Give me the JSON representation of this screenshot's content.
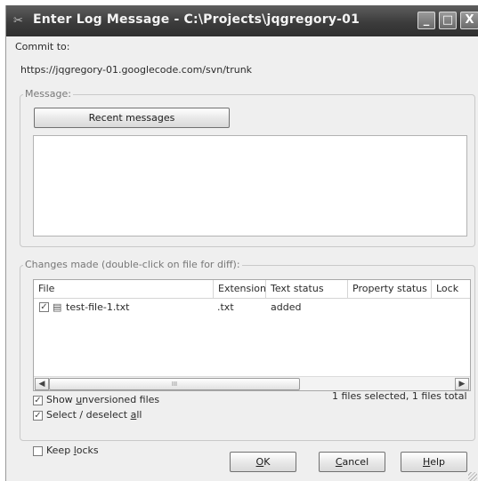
{
  "window": {
    "title": "Enter Log Message - C:\\Projects\\jqgregory-01",
    "min_glyph": "_",
    "max_glyph": "□",
    "close_glyph": "X"
  },
  "commit": {
    "label": "Commit to:",
    "url": "https://jqgregory-01.googlecode.com/svn/trunk"
  },
  "message": {
    "group_label": "Message:",
    "recent_button": "Recent messages",
    "text": ""
  },
  "changes": {
    "group_label": "Changes made (double-click on file for diff):",
    "columns": [
      "File",
      "Extension",
      "Text status",
      "Property status",
      "Lock"
    ],
    "rows": [
      {
        "checked": true,
        "file": "test-file-1.txt",
        "extension": ".txt",
        "text_status": "added",
        "property_status": "",
        "lock": ""
      }
    ],
    "summary": "1 files selected, 1 files total",
    "scroll_thumb_glyph": "III"
  },
  "options": {
    "show_unversioned": {
      "checked": true,
      "label_pre": "Show ",
      "label_key": "u",
      "label_post": "nversioned files"
    },
    "select_all": {
      "checked": true,
      "label_pre": "Select / deselect ",
      "label_key": "a",
      "label_post": "ll"
    },
    "keep_locks": {
      "checked": false,
      "label_pre": "Keep ",
      "label_key": "l",
      "label_post": "ocks"
    }
  },
  "buttons": {
    "ok": {
      "key": "O",
      "rest": "K"
    },
    "cancel": {
      "key": "C",
      "rest": "ancel"
    },
    "help": {
      "key": "H",
      "rest": "elp"
    }
  }
}
